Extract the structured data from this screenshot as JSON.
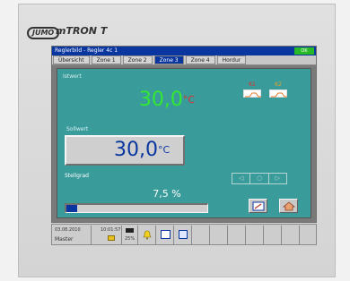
{
  "brand": {
    "logo": "JUMO",
    "model": "mTRON T"
  },
  "titlebar": {
    "title": "Reglerbild - Regler 4c 1",
    "status": "OK"
  },
  "tabs": [
    "Übersicht",
    "Zone 1",
    "Zone 2",
    "Zone 3",
    "Zone 4",
    "Hordur"
  ],
  "active_tab": 3,
  "main": {
    "actual_label": "Istwert",
    "actual_value": "30,0",
    "actual_unit": "°C",
    "k1_label": "K1",
    "k2_label": "K2",
    "setpoint_label": "Sollwert",
    "setpoint_value": "30,0",
    "setpoint_unit": "°C",
    "rate_label": "Stellgrad",
    "rate_value": "7,5 %",
    "rate_fraction": 0.075
  },
  "dock": {
    "date": "03.08.2010",
    "time": "10:01:57",
    "user": "Master",
    "percent": "25%"
  },
  "colors": {
    "screen_bg": "#3a9b9b",
    "actual": "#32e832",
    "setpoint": "#0a36a0",
    "k_label": "#e82a2a",
    "title_bar": "#0a36a0"
  }
}
